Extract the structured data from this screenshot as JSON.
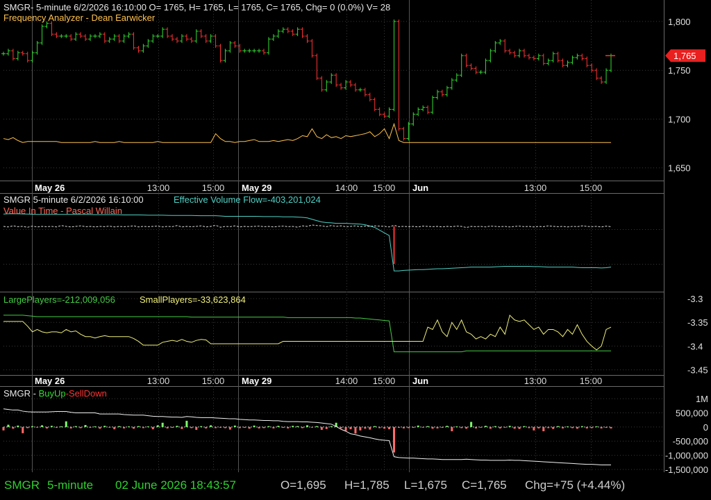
{
  "colors": {
    "up": "#33dd33",
    "down": "#ff3333",
    "price_line": "#ffc24d",
    "flow": "#4fd1c5",
    "value_in_time": "#ff6b5a",
    "large": "#44cc44",
    "small": "#f0f07a",
    "grid": "#3a3a3a",
    "text": "#dddddd",
    "status_green": "#2fd12f"
  },
  "panel1": {
    "title": "SMGR- 5-minute 6/2/2026 16:10:00 O= 1765, H= 1765, L= 1765, C= 1765, Chg= 0 (0.0%) V= 28",
    "subtitle": "Frequency Analyzer - Dean Earwicker",
    "last_price_tag": "1,765"
  },
  "panel2": {
    "title": "SMGR 5-minute  6/2/2026 16:10:00",
    "flow_label": "Effective Volume Flow=-403,201,024",
    "subtitle": "Value In Time - Pascal Willain"
  },
  "panel3": {
    "large_label": "LargePlayers=-212,009,056",
    "small_label": "SmallPlayers=-33,623,864"
  },
  "panel4": {
    "title": "SMGR -",
    "buy_label": "BuyUp",
    "dash": "-",
    "sell_label": "SellDown"
  },
  "status": {
    "symbol": "SMGR",
    "interval": "5-minute",
    "datetime": "02 June 2026 18:43:57",
    "open": "O=1,695",
    "high": "H=1,785",
    "low": "L=1,675",
    "close": "C=1,765",
    "change": "Chg=+75 (+4.44%)"
  },
  "chart_data": [
    {
      "type": "bar",
      "name": "price",
      "ylim": [
        1637,
        1822
      ],
      "yticks": [
        1650,
        1700,
        1750,
        1800
      ],
      "ytick_labels": [
        "1,650",
        "1,700",
        "1,750",
        "1,800"
      ],
      "xtick_labels": [
        "May 26",
        "13:00",
        "15:00",
        "May 29",
        "14:00",
        "15:00",
        "Jun",
        "13:00",
        "15:00"
      ],
      "date_separators": [
        "May 26",
        "May 29",
        "Jun"
      ],
      "close": [
        1767,
        1770,
        1762,
        1768,
        1767,
        1760,
        1768,
        1778,
        1795,
        1798,
        1787,
        1785,
        1785,
        1785,
        1782,
        1787,
        1785,
        1782,
        1785,
        1785,
        1787,
        1780,
        1782,
        1785,
        1780,
        1785,
        1787,
        1773,
        1770,
        1775,
        1780,
        1785,
        1785,
        1792,
        1785,
        1782,
        1780,
        1785,
        1782,
        1780,
        1790,
        1785,
        1780,
        1785,
        1775,
        1760,
        1770,
        1778,
        1775,
        1770,
        1770,
        1770,
        1770,
        1770,
        1768,
        1782,
        1785,
        1790,
        1792,
        1790,
        1787,
        1792,
        1785,
        1780,
        1765,
        1742,
        1730,
        1738,
        1745,
        1735,
        1732,
        1738,
        1735,
        1730,
        1730,
        1725,
        1720,
        1710,
        1705,
        1703,
        1710,
        1800,
        1690,
        1680,
        1695,
        1705,
        1710,
        1712,
        1707,
        1722,
        1728,
        1725,
        1732,
        1740,
        1745,
        1765,
        1755,
        1752,
        1748,
        1748,
        1760,
        1770,
        1778,
        1780,
        1770,
        1768,
        1765,
        1770,
        1765,
        1763,
        1762,
        1765,
        1757,
        1760,
        1767,
        1760,
        1755,
        1758,
        1763,
        1765,
        1762,
        1755,
        1750,
        1742,
        1738,
        1750,
        1765
      ],
      "last_price": 1765
    },
    {
      "type": "line",
      "name": "Frequency Analyzer - Dean Earwicker",
      "y": [
        1680,
        1679,
        1681,
        1678,
        1676,
        1677,
        1677,
        1677,
        1677,
        1677,
        1677,
        1677,
        1676,
        1676,
        1676,
        1676,
        1676,
        1676,
        1676,
        1677,
        1676,
        1676,
        1676,
        1676,
        1677,
        1676,
        1676,
        1676,
        1676,
        1676,
        1676,
        1676,
        1677,
        1676,
        1676,
        1676,
        1676,
        1676,
        1676,
        1676,
        1676,
        1676,
        1676,
        1676,
        1685,
        1680,
        1677,
        1677,
        1676,
        1677,
        1677,
        1678,
        1679,
        1677,
        1677,
        1677,
        1678,
        1677,
        1678,
        1679,
        1678,
        1680,
        1683,
        1682,
        1690,
        1682,
        1680,
        1684,
        1681,
        1682,
        1680,
        1683,
        1682,
        1683,
        1684,
        1685,
        1687,
        1682,
        1685,
        1690,
        1680,
        1695,
        1678,
        1676,
        1676,
        1676,
        1676,
        1676,
        1676,
        1676,
        1676,
        1676,
        1676,
        1676,
        1676,
        1676,
        1676,
        1676,
        1676,
        1676,
        1676,
        1676,
        1676,
        1676,
        1676,
        1676,
        1676,
        1676,
        1676,
        1676,
        1676,
        1676,
        1676,
        1676,
        1676,
        1676,
        1676,
        1676,
        1676,
        1676,
        1676,
        1676,
        1676,
        1676,
        1676,
        1676,
        1676
      ]
    },
    {
      "type": "line",
      "name": "Effective Volume Flow",
      "y": [
        0.9,
        1,
        1,
        1,
        0.95,
        0.9,
        0.85,
        0.8,
        0.8,
        0.8,
        0.8,
        0.8,
        0.8,
        0.8,
        0.8,
        0.8,
        0.8,
        0.8,
        0.75,
        0.7,
        0.7,
        0.7,
        0.7,
        0.7,
        0.65,
        0.6,
        0.6,
        0.6,
        0.6,
        0.55,
        0.5,
        0.5,
        0.5,
        0.5,
        0.45,
        0.4,
        0.4,
        0.4,
        0.4,
        0.4,
        0.35,
        0.3,
        0.3,
        0.3,
        0.3,
        0.2,
        0.1,
        0.1,
        0.1,
        0.1,
        0.1,
        0.1,
        0.1,
        0.05,
        0,
        0,
        0,
        0,
        -0.1,
        -0.1,
        -0.1,
        -0.2,
        -0.3,
        -0.5,
        -1,
        -1.5,
        -2,
        -2.2,
        -2.3,
        -2.5,
        -2.5,
        -2.5,
        -2.6,
        -2.7,
        -2.8,
        -3,
        -3.5,
        -4,
        -5,
        -6,
        -7,
        -20,
        -20,
        -19.8,
        -19.7,
        -19.6,
        -19.5,
        -19.5,
        -19.4,
        -19.3,
        -19.2,
        -19.2,
        -19.1,
        -19,
        -18.9,
        -18.8,
        -18.7,
        -18.6,
        -18.6,
        -18.6,
        -18.6,
        -18.6,
        -18.5,
        -18.4,
        -18.3,
        -18.3,
        -18.3,
        -18.3,
        -18.3,
        -18.3,
        -18.4,
        -18.4,
        -18.5,
        -18.6,
        -18.6,
        -18.6,
        -18.6,
        -18.6,
        -18.6,
        -18.7,
        -18.8,
        -18.8,
        -18.8,
        -18.8,
        -18.9,
        -18.8,
        -18.6
      ]
    },
    {
      "type": "line",
      "name": "Value In Time",
      "y": [
        0,
        0.2,
        -0.2,
        0.1,
        0,
        0.3,
        -0.1,
        0.2,
        0,
        0.1,
        0,
        0.2,
        -0.3,
        0,
        0.2,
        0,
        -0.2,
        0.1,
        0,
        0.2,
        0,
        0.1,
        -0.1,
        0.2,
        0,
        0.1,
        0,
        -0.2,
        0.2,
        0,
        0.1,
        0,
        -0.1,
        0.2,
        0,
        0.1,
        -0.3,
        0.2,
        0,
        0.1,
        0,
        -0.2,
        0.2,
        0,
        -0.4,
        0.3,
        0,
        0.1,
        -0.2,
        0.2,
        0,
        0.1,
        0,
        -0.1,
        0.1,
        0,
        0.2,
        0,
        -0.1,
        0.1,
        0,
        0.3,
        -0.2,
        0,
        -0.5,
        -0.3,
        -0.2,
        0.1,
        -0.3,
        0,
        -0.2,
        0.1,
        0,
        -0.2,
        0.1,
        -0.1,
        0,
        -0.2,
        -0.1,
        0,
        0.2,
        -0.4,
        0.1,
        0,
        0.1,
        0,
        0.2,
        -0.1,
        0,
        0.1,
        0,
        0.2,
        0,
        0.1,
        -0.1,
        0,
        0.4,
        0,
        0.1,
        0,
        0.2,
        -0.1,
        0,
        0.1,
        0,
        0.2,
        0,
        -0.1,
        0.1,
        0,
        0.2,
        0,
        0.1,
        -0.2,
        0,
        0.1,
        0,
        0.2,
        0,
        0.1,
        -0.2,
        0,
        0.1,
        0,
        0.2,
        -0.1,
        0.1
      ]
    },
    {
      "type": "line",
      "name": "LargePlayers / SmallPlayers",
      "ylim": [
        -3.455,
        -3.3
      ],
      "yticks": [
        -3.3,
        -3.35,
        -3.4,
        -3.45
      ],
      "ytick_labels": [
        "-3.3",
        "-3.35",
        "-3.4",
        "-3.45"
      ],
      "large": [
        -3.335,
        -3.335,
        -3.335,
        -3.335,
        -3.335,
        -3.336,
        -3.337,
        -3.338,
        -3.338,
        -3.338,
        -3.338,
        -3.338,
        -3.338,
        -3.338,
        -3.338,
        -3.338,
        -3.338,
        -3.338,
        -3.338,
        -3.338,
        -3.338,
        -3.338,
        -3.338,
        -3.338,
        -3.338,
        -3.338,
        -3.338,
        -3.338,
        -3.338,
        -3.338,
        -3.338,
        -3.338,
        -3.338,
        -3.338,
        -3.338,
        -3.338,
        -3.338,
        -3.338,
        -3.338,
        -3.339,
        -3.339,
        -3.339,
        -3.339,
        -3.339,
        -3.339,
        -3.339,
        -3.339,
        -3.339,
        -3.339,
        -3.339,
        -3.339,
        -3.339,
        -3.339,
        -3.339,
        -3.339,
        -3.339,
        -3.339,
        -3.339,
        -3.339,
        -3.34,
        -3.34,
        -3.34,
        -3.34,
        -3.34,
        -3.34,
        -3.34,
        -3.34,
        -3.34,
        -3.34,
        -3.34,
        -3.34,
        -3.34,
        -3.34,
        -3.341,
        -3.341,
        -3.342,
        -3.343,
        -3.344,
        -3.345,
        -3.346,
        -3.347,
        -3.412,
        -3.412,
        -3.412,
        -3.412,
        -3.412,
        -3.412,
        -3.412,
        -3.412,
        -3.412,
        -3.412,
        -3.412,
        -3.412,
        -3.412,
        -3.412,
        -3.412,
        -3.41,
        -3.41,
        -3.41,
        -3.41,
        -3.41,
        -3.41,
        -3.41,
        -3.41,
        -3.41,
        -3.41,
        -3.41,
        -3.41,
        -3.41,
        -3.41,
        -3.41,
        -3.41,
        -3.41,
        -3.41,
        -3.41,
        -3.41,
        -3.41,
        -3.41,
        -3.41,
        -3.41,
        -3.41,
        -3.41,
        -3.41,
        -3.41,
        -3.41,
        -3.41,
        -3.41
      ],
      "small": [
        -3.348,
        -3.348,
        -3.348,
        -3.348,
        -3.348,
        -3.358,
        -3.37,
        -3.365,
        -3.37,
        -3.372,
        -3.37,
        -3.37,
        -3.372,
        -3.365,
        -3.37,
        -3.368,
        -3.375,
        -3.38,
        -3.38,
        -3.383,
        -3.38,
        -3.378,
        -3.38,
        -3.38,
        -3.38,
        -3.38,
        -3.38,
        -3.384,
        -3.39,
        -3.398,
        -3.398,
        -3.398,
        -3.398,
        -3.392,
        -3.39,
        -3.388,
        -3.39,
        -3.386,
        -3.39,
        -3.392,
        -3.388,
        -3.386,
        -3.387,
        -3.395,
        -3.395,
        -3.395,
        -3.395,
        -3.395,
        -3.395,
        -3.395,
        -3.395,
        -3.395,
        -3.395,
        -3.395,
        -3.395,
        -3.395,
        -3.395,
        -3.395,
        -3.39,
        -3.39,
        -3.39,
        -3.39,
        -3.39,
        -3.39,
        -3.39,
        -3.39,
        -3.39,
        -3.39,
        -3.39,
        -3.39,
        -3.39,
        -3.39,
        -3.39,
        -3.39,
        -3.39,
        -3.39,
        -3.39,
        -3.39,
        -3.39,
        -3.39,
        -3.39,
        -3.39,
        -3.39,
        -3.39,
        -3.39,
        -3.39,
        -3.39,
        -3.39,
        -3.36,
        -3.365,
        -3.345,
        -3.37,
        -3.38,
        -3.35,
        -3.365,
        -3.345,
        -3.37,
        -3.375,
        -3.385,
        -3.38,
        -3.385,
        -3.375,
        -3.38,
        -3.36,
        -3.375,
        -3.335,
        -3.345,
        -3.348,
        -3.345,
        -3.355,
        -3.365,
        -3.36,
        -3.375,
        -3.365,
        -3.365,
        -3.37,
        -3.38,
        -3.365,
        -3.375,
        -3.355,
        -3.375,
        -3.39,
        -3.4,
        -3.408,
        -3.4,
        -3.365,
        -3.36
      ]
    },
    {
      "type": "bar",
      "name": "BuyUp-SellDown",
      "ylim": [
        -1550000,
        1200000
      ],
      "yticks": [
        1000000,
        500000,
        0,
        -500000,
        -1000000,
        -1500000
      ],
      "ytick_labels": [
        "1M",
        "500,000",
        "0",
        "-500,000",
        "-1,000,000",
        "-1,500,000"
      ],
      "values": [
        -120000,
        80000,
        -60000,
        50000,
        -220000,
        -40000,
        30000,
        -20000,
        60000,
        -50000,
        40000,
        -30000,
        20000,
        200000,
        -50000,
        30000,
        -40000,
        70000,
        -30000,
        20000,
        -60000,
        40000,
        -20000,
        -80000,
        30000,
        -50000,
        20000,
        -60000,
        30000,
        -40000,
        20000,
        -80000,
        60000,
        150000,
        -50000,
        -30000,
        40000,
        -70000,
        220000,
        -40000,
        -100000,
        30000,
        -50000,
        60000,
        -40000,
        -30000,
        -40000,
        -90000,
        50000,
        -40000,
        -30000,
        -60000,
        50000,
        -50000,
        -40000,
        30000,
        -50000,
        40000,
        -30000,
        -50000,
        40000,
        30000,
        -40000,
        60000,
        -20000,
        30000,
        -100000,
        -70000,
        30000,
        150000,
        -50000,
        -130000,
        -80000,
        -230000,
        -120000,
        -60000,
        -90000,
        30000,
        -40000,
        -60000,
        -80000,
        -900000,
        -30000,
        -50000,
        -40000,
        -30000,
        50000,
        -20000,
        30000,
        -60000,
        -50000,
        -30000,
        40000,
        -150000,
        20000,
        -40000,
        -60000,
        180000,
        -50000,
        -20000,
        40000,
        -60000,
        30000,
        -50000,
        -20000,
        40000,
        -60000,
        -70000,
        30000,
        -40000,
        -120000,
        -50000,
        -150000,
        -40000,
        -70000,
        30000,
        -50000,
        20000,
        -40000,
        -60000,
        30000,
        -50000,
        -40000,
        20000,
        -50000,
        -30000,
        -50000
      ],
      "cumulative": [
        640000,
        620000,
        600000,
        600000,
        560000,
        540000,
        530000,
        530000,
        530000,
        530000,
        540000,
        550000,
        550000,
        550000,
        520000,
        500000,
        500000,
        500000,
        500000,
        500000,
        460000,
        460000,
        460000,
        460000,
        460000,
        440000,
        430000,
        420000,
        420000,
        420000,
        400000,
        380000,
        370000,
        370000,
        360000,
        350000,
        350000,
        340000,
        370000,
        360000,
        340000,
        330000,
        330000,
        330000,
        320000,
        310000,
        300000,
        290000,
        290000,
        270000,
        260000,
        250000,
        250000,
        240000,
        230000,
        230000,
        220000,
        220000,
        200000,
        190000,
        190000,
        190000,
        180000,
        180000,
        170000,
        160000,
        140000,
        120000,
        100000,
        20000,
        -80000,
        -150000,
        -240000,
        -270000,
        -320000,
        -350000,
        -380000,
        -420000,
        -450000,
        -470000,
        -480000,
        -1050000,
        -1080000,
        -1090000,
        -1100000,
        -1100000,
        -1110000,
        -1120000,
        -1130000,
        -1130000,
        -1140000,
        -1150000,
        -1150000,
        -1150000,
        -1150000,
        -1150000,
        -1140000,
        -1150000,
        -1160000,
        -1170000,
        -1170000,
        -1180000,
        -1180000,
        -1180000,
        -1180000,
        -1170000,
        -1180000,
        -1180000,
        -1190000,
        -1200000,
        -1210000,
        -1220000,
        -1230000,
        -1240000,
        -1250000,
        -1260000,
        -1270000,
        -1280000,
        -1290000,
        -1300000,
        -1310000,
        -1320000,
        -1320000,
        -1330000,
        -1340000,
        -1340000,
        -1340000
      ]
    }
  ]
}
